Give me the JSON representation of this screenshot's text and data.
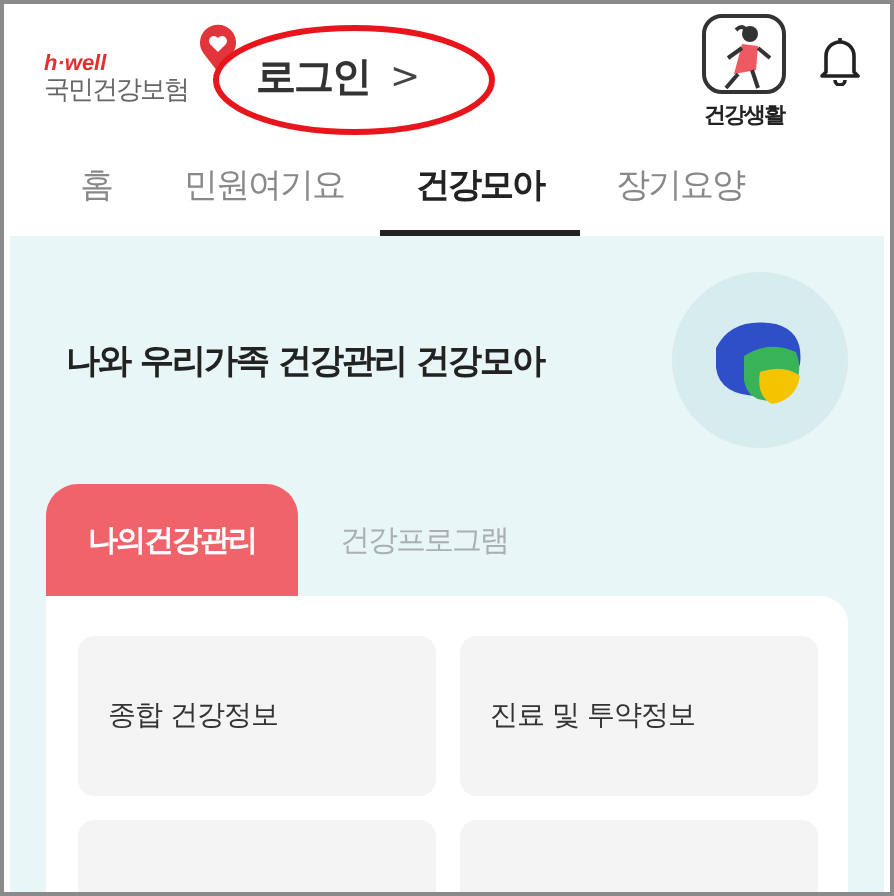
{
  "header": {
    "logo": {
      "tagline": "h·well",
      "name": "국민건강보험"
    },
    "login": {
      "label": "로그인",
      "chevron": ">",
      "highlighted": true
    },
    "health_life": {
      "label": "건강생활"
    }
  },
  "tabs": [
    {
      "label": "홈",
      "selected": false
    },
    {
      "label": "민원여기요",
      "selected": false
    },
    {
      "label": "건강모아",
      "selected": true
    },
    {
      "label": "장기요양",
      "selected": false
    }
  ],
  "panel": {
    "title": "나와 우리가족 건강관리 건강모아",
    "subtabs": [
      {
        "label": "나의건강관리",
        "selected": true
      },
      {
        "label": "건강프로그램",
        "selected": false
      }
    ],
    "menu_items": [
      {
        "label": "종합 건강정보"
      },
      {
        "label": "진료 및 투약정보"
      },
      {
        "cut_off": true
      },
      {
        "cut_off": true
      }
    ]
  }
}
